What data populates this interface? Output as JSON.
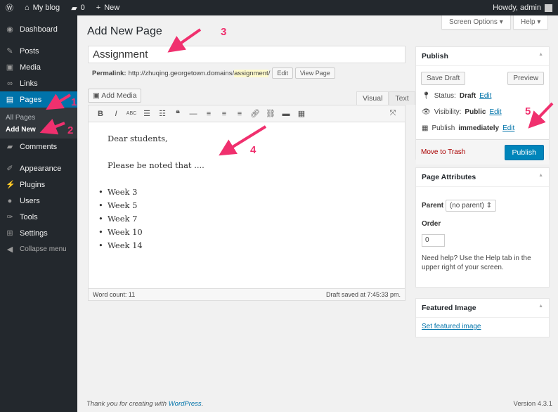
{
  "adminbar": {
    "site": "My blog",
    "comments": "0",
    "new": "New",
    "howdy": "Howdy, admin"
  },
  "sidebar": {
    "items": [
      {
        "label": "Dashboard",
        "icon": "dashboard-icon"
      },
      {
        "label": "Posts",
        "icon": "pin-icon"
      },
      {
        "label": "Media",
        "icon": "media-icon"
      },
      {
        "label": "Links",
        "icon": "link-icon"
      },
      {
        "label": "Pages",
        "icon": "page-icon"
      },
      {
        "label": "Comments",
        "icon": "comment-icon"
      },
      {
        "label": "Appearance",
        "icon": "brush-icon"
      },
      {
        "label": "Plugins",
        "icon": "plugin-icon"
      },
      {
        "label": "Users",
        "icon": "user-icon"
      },
      {
        "label": "Tools",
        "icon": "wrench-icon"
      },
      {
        "label": "Settings",
        "icon": "settings-icon"
      },
      {
        "label": "Collapse menu",
        "icon": "collapse-icon"
      }
    ],
    "submenu": [
      "All Pages",
      "Add New"
    ]
  },
  "header": {
    "title": "Add New Page",
    "screen_options": "Screen Options ▾",
    "help": "Help ▾"
  },
  "editor": {
    "title_value": "Assignment",
    "permalink_label": "Permalink:",
    "permalink_base": "http://zhuqing.georgetown.domains/",
    "permalink_slug": "assignment",
    "permalink_end": "/",
    "edit": "Edit",
    "view_page": "View Page",
    "add_media": "Add Media",
    "tab_visual": "Visual",
    "tab_text": "Text",
    "content": {
      "p1": "Dear students,",
      "p2": "Please be noted that ....",
      "list": [
        "Week 3",
        "Week 5",
        "Week 7",
        "Week 10",
        "Week 14"
      ]
    },
    "word_count": "Word count: 11",
    "draft_saved": "Draft saved at 7:45:33 pm."
  },
  "publish": {
    "title": "Publish",
    "save_draft": "Save Draft",
    "preview": "Preview",
    "status_label": "Status:",
    "status": "Draft",
    "visibility_label": "Visibility:",
    "visibility": "Public",
    "publish_label": "Publish",
    "publish_when": "immediately",
    "edit": "Edit",
    "trash": "Move to Trash",
    "publish_button": "Publish",
    "accent": "#0085ba"
  },
  "attributes": {
    "title": "Page Attributes",
    "parent_label": "Parent",
    "parent_value": "(no parent)",
    "order_label": "Order",
    "order_value": "0",
    "help": "Need help? Use the Help tab in the upper right of your screen."
  },
  "featured": {
    "title": "Featured Image",
    "link": "Set featured image"
  },
  "footer": {
    "thanks": "Thank you for creating with ",
    "wp": "WordPress",
    "thanks_end": ".",
    "version": "Version 4.3.1"
  },
  "annotations": {
    "color": "#f0306e",
    "labels": [
      "1",
      "2",
      "3",
      "4",
      "5"
    ]
  }
}
